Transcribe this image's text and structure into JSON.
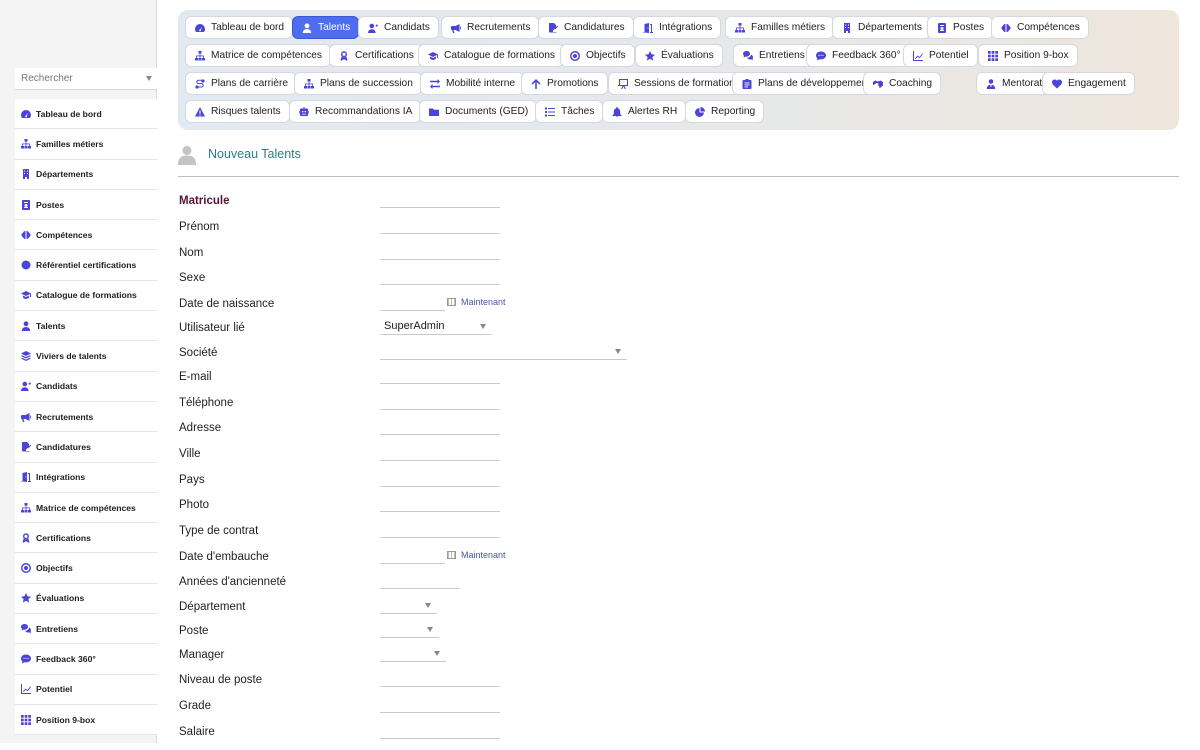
{
  "sidebar": {
    "search_placeholder": "Rechercher",
    "items": [
      {
        "label": "Tableau de bord",
        "icon": "dashboard-icon"
      },
      {
        "label": "Familles métiers",
        "icon": "sitemap-icon"
      },
      {
        "label": "Départements",
        "icon": "building-icon"
      },
      {
        "label": "Postes",
        "icon": "id-badge-icon"
      },
      {
        "label": "Compétences",
        "icon": "brain-icon"
      },
      {
        "label": "Référentiel certifications",
        "icon": "circle-icon"
      },
      {
        "label": "Catalogue de formations",
        "icon": "graduation-cap-icon"
      },
      {
        "label": "Talents",
        "icon": "user-icon"
      },
      {
        "label": "Viviers de talents",
        "icon": "layers-icon"
      },
      {
        "label": "Candidats",
        "icon": "user-plus-icon"
      },
      {
        "label": "Recrutements",
        "icon": "bullhorn-icon"
      },
      {
        "label": "Candidatures",
        "icon": "file-signature-icon"
      },
      {
        "label": "Intégrations",
        "icon": "door-open-icon"
      },
      {
        "label": "Matrice de compétences",
        "icon": "sitemap-icon"
      },
      {
        "label": "Certifications",
        "icon": "award-icon"
      },
      {
        "label": "Objectifs",
        "icon": "target-icon"
      },
      {
        "label": "Évaluations",
        "icon": "star-icon"
      },
      {
        "label": "Entretiens",
        "icon": "comments-icon"
      },
      {
        "label": "Feedback 360°",
        "icon": "comment-dots-icon"
      },
      {
        "label": "Potentiel",
        "icon": "chart-line-icon"
      },
      {
        "label": "Position 9-box",
        "icon": "grid-icon"
      }
    ]
  },
  "tabs": [
    {
      "label": "Tableau de bord",
      "icon": "dashboard-icon",
      "active": false
    },
    {
      "label": "Talents",
      "icon": "user-icon",
      "active": true
    },
    {
      "label": "Candidats",
      "icon": "user-plus-icon",
      "active": false
    },
    {
      "label": "Recrutements",
      "icon": "bullhorn-icon",
      "active": false
    },
    {
      "label": "Candidatures",
      "icon": "file-signature-icon",
      "active": false
    },
    {
      "label": "Intégrations",
      "icon": "door-open-icon",
      "active": false
    },
    {
      "label": "Familles métiers",
      "icon": "sitemap-icon",
      "active": false
    },
    {
      "label": "Départements",
      "icon": "building-icon",
      "active": false
    },
    {
      "label": "Postes",
      "icon": "id-badge-icon",
      "active": false
    },
    {
      "label": "Compétences",
      "icon": "brain-icon",
      "active": false
    },
    {
      "label": "Matrice de compétences",
      "icon": "sitemap-icon",
      "active": false
    },
    {
      "label": "Certifications",
      "icon": "award-icon",
      "active": false
    },
    {
      "label": "Catalogue de formations",
      "icon": "graduation-cap-icon",
      "active": false
    },
    {
      "label": "Objectifs",
      "icon": "target-icon",
      "active": false
    },
    {
      "label": "Évaluations",
      "icon": "star-icon",
      "active": false
    },
    {
      "label": "Entretiens",
      "icon": "comments-icon",
      "active": false
    },
    {
      "label": "Feedback 360°",
      "icon": "comment-dots-icon",
      "active": false
    },
    {
      "label": "Potentiel",
      "icon": "chart-line-icon",
      "active": false
    },
    {
      "label": "Position 9-box",
      "icon": "grid-icon",
      "active": false
    },
    {
      "label": "Plans de carrière",
      "icon": "route-icon",
      "active": false
    },
    {
      "label": "Plans de succession",
      "icon": "sitemap-icon",
      "active": false
    },
    {
      "label": "Mobilité interne",
      "icon": "exchange-icon",
      "active": false
    },
    {
      "label": "Promotions",
      "icon": "arrow-up-icon",
      "active": false
    },
    {
      "label": "Sessions de formation",
      "icon": "chalkboard-icon",
      "active": false
    },
    {
      "label": "Plans de développement",
      "icon": "clipboard-icon",
      "active": false
    },
    {
      "label": "Coaching",
      "icon": "handshake-icon",
      "active": false
    },
    {
      "label": "Mentorat",
      "icon": "user-tie-icon",
      "active": false
    },
    {
      "label": "Engagement",
      "icon": "heart-icon",
      "active": false
    },
    {
      "label": "Risques talents",
      "icon": "warning-icon",
      "active": false
    },
    {
      "label": "Recommandations IA",
      "icon": "robot-icon",
      "active": false
    },
    {
      "label": "Documents (GED)",
      "icon": "folder-icon",
      "active": false
    },
    {
      "label": "Tâches",
      "icon": "tasks-icon",
      "active": false
    },
    {
      "label": "Alertes RH",
      "icon": "bell-icon",
      "active": false
    },
    {
      "label": "Reporting",
      "icon": "pie-chart-icon",
      "active": false
    }
  ],
  "page": {
    "title": "Nouveau Talents",
    "avatar_icon": "user-silhouette-icon"
  },
  "form": {
    "now_label": "Maintenant",
    "fields": [
      {
        "label": "Matricule",
        "type": "text",
        "value": "",
        "required": true
      },
      {
        "label": "Prénom",
        "type": "text",
        "value": ""
      },
      {
        "label": "Nom",
        "type": "text",
        "value": ""
      },
      {
        "label": "Sexe",
        "type": "text",
        "value": ""
      },
      {
        "label": "Date de naissance",
        "type": "date",
        "value": ""
      },
      {
        "label": "Utilisateur lié",
        "type": "select",
        "value": "SuperAdmin"
      },
      {
        "label": "Société",
        "type": "select",
        "value": ""
      },
      {
        "label": "E-mail",
        "type": "text",
        "value": ""
      },
      {
        "label": "Téléphone",
        "type": "text",
        "value": ""
      },
      {
        "label": "Adresse",
        "type": "text",
        "value": ""
      },
      {
        "label": "Ville",
        "type": "text",
        "value": ""
      },
      {
        "label": "Pays",
        "type": "text",
        "value": ""
      },
      {
        "label": "Photo",
        "type": "text",
        "value": ""
      },
      {
        "label": "Type de contrat",
        "type": "text",
        "value": ""
      },
      {
        "label": "Date d'embauche",
        "type": "date",
        "value": ""
      },
      {
        "label": "Années d'ancienneté",
        "type": "text",
        "value": ""
      },
      {
        "label": "Département",
        "type": "select",
        "value": ""
      },
      {
        "label": "Poste",
        "type": "select",
        "value": ""
      },
      {
        "label": "Manager",
        "type": "select",
        "value": ""
      },
      {
        "label": "Niveau de poste",
        "type": "text",
        "value": ""
      },
      {
        "label": "Grade",
        "type": "text",
        "value": ""
      },
      {
        "label": "Salaire",
        "type": "text",
        "value": ""
      }
    ]
  },
  "colors": {
    "accent": "#4e6df0",
    "icon": "#4b44d6",
    "title": "#2a7f86",
    "required_label": "#5a1138"
  }
}
